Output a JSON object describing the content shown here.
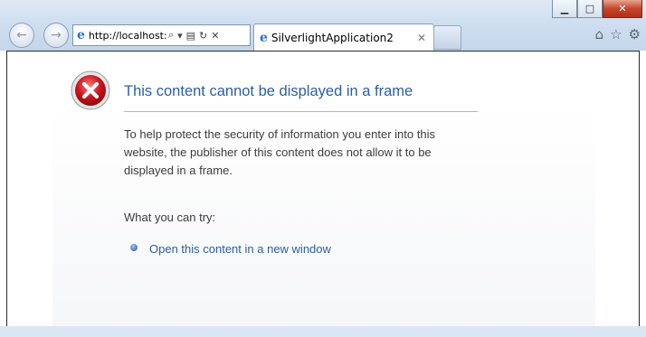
{
  "window": {
    "minimize_icon": "minimize-icon",
    "maximize_icon": "maximize-icon",
    "close_icon": "close-icon"
  },
  "toolbar": {
    "address": "http://localhost:",
    "search_icon": "search-icon",
    "dropdown_icon": "chevron-down-icon",
    "compat_icon": "compatibility-view-icon",
    "refresh_icon": "refresh-icon",
    "stop_icon": "stop-icon",
    "back_icon": "back-arrow-icon",
    "forward_icon": "forward-arrow-icon",
    "home_icon": "home-icon",
    "favorites_icon": "star-icon",
    "tools_icon": "gear-icon"
  },
  "tabs": [
    {
      "label": "SilverlightApplication2",
      "icon": "ie-icon",
      "close_icon": "close-icon"
    }
  ],
  "page": {
    "error_icon": "error-x-icon",
    "headline": "This content cannot be displayed in a frame",
    "paragraph": "To help protect the security of information you enter into this website, the publisher of this content does not allow it to be displayed in a frame.",
    "try_label": "What you can try:",
    "link_label": "Open this content in a new window"
  },
  "colors": {
    "link": "#2b5ea7",
    "error_red": "#c0191e",
    "chrome": "#cfdff0"
  }
}
